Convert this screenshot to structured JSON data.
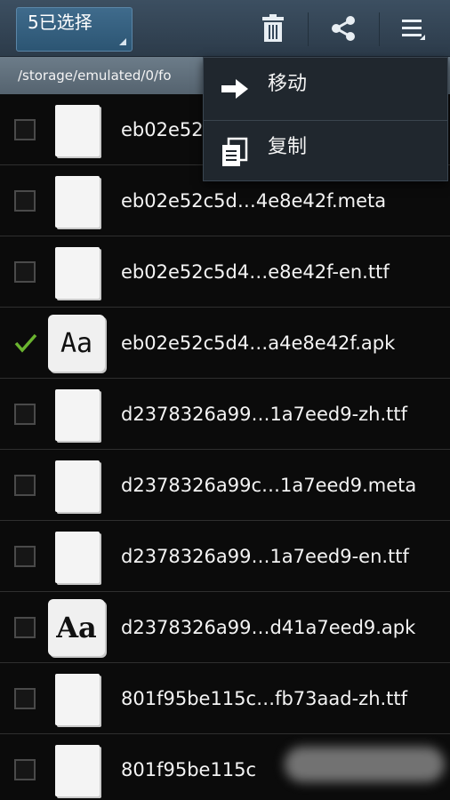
{
  "actionbar": {
    "select_count": "5已选择",
    "delete_icon": "trash-icon",
    "share_icon": "share-icon",
    "overflow_icon": "overflow-menu-icon"
  },
  "path": "/storage/emulated/0/fo",
  "menu": {
    "items": [
      {
        "label": "移动",
        "icon": "move-arrow-icon"
      },
      {
        "label": "复制",
        "icon": "copy-icon"
      }
    ]
  },
  "files": [
    {
      "name": "eb02e52",
      "checked": false,
      "thumb": "blank"
    },
    {
      "name": "eb02e52c5d…4e8e42f.meta",
      "checked": false,
      "thumb": "blank"
    },
    {
      "name": "eb02e52c5d4…e8e42f-en.ttf",
      "checked": false,
      "thumb": "blank"
    },
    {
      "name": "eb02e52c5d4…a4e8e42f.apk",
      "checked": true,
      "thumb": "font-handwritten",
      "thumb_text": "Aa"
    },
    {
      "name": "d2378326a99…1a7eed9-zh.ttf",
      "checked": false,
      "thumb": "blank"
    },
    {
      "name": "d2378326a99c…1a7eed9.meta",
      "checked": false,
      "thumb": "blank"
    },
    {
      "name": "d2378326a99…1a7eed9-en.ttf",
      "checked": false,
      "thumb": "blank"
    },
    {
      "name": "d2378326a99…d41a7eed9.apk",
      "checked": false,
      "thumb": "font-serif",
      "thumb_text": "Aa"
    },
    {
      "name": "801f95be115c…fb73aad-zh.ttf",
      "checked": false,
      "thumb": "blank"
    },
    {
      "name": "801f95be115c",
      "checked": false,
      "thumb": "blank"
    }
  ],
  "colors": {
    "actionbar": "#34475a",
    "check_green": "#6ab42f",
    "list_bg": "#0b0b0b"
  }
}
